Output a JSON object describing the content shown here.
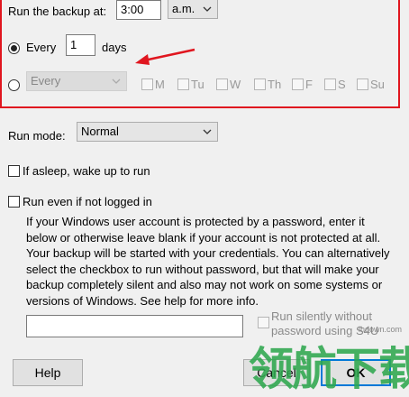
{
  "schedule": {
    "run_at_label": "Run the backup at:",
    "time_value": "3:00",
    "ampm_value": "a.m.",
    "every_label": "Every",
    "every_days_value": "1",
    "days_label": "days",
    "weekday_combo_value": "Every",
    "weekdays": [
      "M",
      "Tu",
      "W",
      "Th",
      "F",
      "S",
      "Su"
    ]
  },
  "run_mode": {
    "label": "Run mode:",
    "value": "Normal"
  },
  "options": {
    "asleep_label": "If asleep, wake up to run",
    "not_logged_label": "Run even if not logged in",
    "description_lines": [
      "If your Windows user account is protected by a password, enter it",
      "below or otherwise leave blank if your account is not protected at all.",
      "Your backup will be started with your credentials. You can alternatively",
      "select the checkbox to run without password, but that will make your",
      "backup completely silent and also may not work on some systems or",
      "versions of Windows. See help for more info."
    ],
    "password_value": "",
    "s4u_line1": "Run silently without",
    "s4u_line2": "password using S4U"
  },
  "buttons": {
    "help": "Help",
    "cancel": "Cancel",
    "ok": "OK"
  },
  "watermark": {
    "text": "领航下载",
    "site": "lhdown.com"
  },
  "colors": {
    "highlight_box": "#e0161f",
    "arrow": "#e0161f",
    "watermark": "#2fa84f",
    "default_button_border": "#0078d7"
  }
}
